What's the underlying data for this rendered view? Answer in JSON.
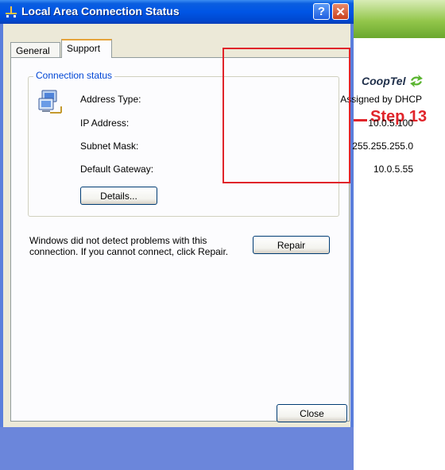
{
  "window": {
    "title": "Local Area Connection Status",
    "help_glyph": "?",
    "close_glyph": "✕"
  },
  "tabs": [
    {
      "label": "General"
    },
    {
      "label": "Support"
    }
  ],
  "connection_status": {
    "group_title": "Connection status",
    "rows": [
      {
        "label": "Address Type:",
        "value": "Assigned by DHCP"
      },
      {
        "label": "IP Address:",
        "value": "10.0.5.100"
      },
      {
        "label": "Subnet Mask:",
        "value": "255.255.255.0"
      },
      {
        "label": "Default Gateway:",
        "value": "10.0.5.55"
      }
    ],
    "details_button": "Details..."
  },
  "diagnostics": {
    "message": "Windows did not detect problems with this connection. If you cannot connect, click Repair.",
    "repair_button": "Repair"
  },
  "footer": {
    "close_button": "Close"
  },
  "annotation": {
    "brand": "CoopTel",
    "step_label": "Step 13",
    "highlight_color": "#e0242a"
  },
  "icons": {
    "title": "network-connection-icon",
    "connection": "network-computer-icon",
    "brand": "cooptel-logo-icon"
  }
}
